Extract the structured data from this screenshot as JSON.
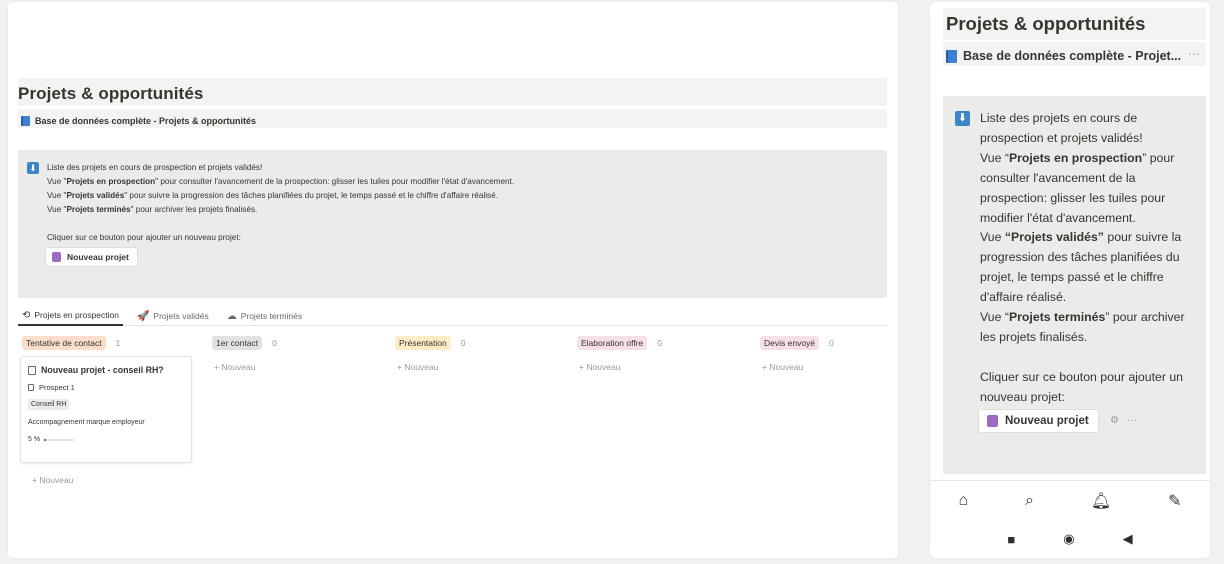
{
  "desktop": {
    "title": "Projets & opportunités",
    "subtitle": "Base de données complète - Projets & opportunités",
    "callout": {
      "lines": [
        {
          "pre": "Liste des projets en cours de prospection et projets validés!",
          "bold": "",
          "post": ""
        },
        {
          "pre": "Vue \"",
          "bold": "Projets en prospection",
          "post": "\" pour consulter l'avancement de la prospection: glisser les tuiles pour modifier l'état d'avancement."
        },
        {
          "pre": "Vue \"",
          "bold": "Projets validés",
          "post": "\" pour suivre la progression des tâches planifiées du projet, le temps passé et le chiffre d'affaire réalisé."
        },
        {
          "pre": "Vue \"",
          "bold": "Projets terminés",
          "post": "\" pour archiver les projets finalisés."
        }
      ],
      "cta_text": "Cliquer sur ce bouton pour ajouter un nouveau projet:",
      "button": "Nouveau projet"
    },
    "tabs": [
      {
        "label": "Projets en prospection",
        "icon": "sync-icon"
      },
      {
        "label": "Projets validés",
        "icon": "rocket-icon"
      },
      {
        "label": "Projets terminés",
        "icon": "cloud-icon"
      }
    ],
    "columns": [
      {
        "label": "Tentative de contact",
        "count": "1",
        "color": "#fadec9"
      },
      {
        "label": "1er contact",
        "count": "0",
        "color": "#e3e2e0"
      },
      {
        "label": "Présentation",
        "count": "0",
        "color": "#fdecc8"
      },
      {
        "label": "Elaboration offre",
        "count": "0",
        "color": "#f5e0e9"
      },
      {
        "label": "Devis envoyé",
        "count": "0",
        "color": "#f5e0e9"
      }
    ],
    "add_new": "+ Nouveau",
    "card": {
      "title": "Nouveau projet - conseil RH?",
      "prospect": "Prospect 1",
      "tag": "Conseil RH",
      "description": "Accompagnement marque employeur",
      "progress_label": "5 %",
      "progress": 0.05
    }
  },
  "mobile": {
    "title": "Projets & opportunités",
    "subtitle": "Base de données complète - Projet...",
    "more": "···",
    "callout": {
      "intro": "Liste des projets en cours de prospection et projets validés!",
      "p1_pre": "Vue “",
      "p1_bold": "Projets en prospection",
      "p1_post": "” pour consulter l'avancement de la prospection: glisser les tuiles pour modifier l'état d'avancement.",
      "p2_pre": "Vue ",
      "p2_bold": "“Projets validés”",
      "p2_post": " pour suivre la progression des tâches planifiées du projet, le temps passé et le chiffre d'affaire réalisé.",
      "p3_pre": "Vue “",
      "p3_bold": "Projets terminés",
      "p3_post": "” pour archiver les projets finalisés.",
      "cta_text": "Cliquer sur ce bouton pour ajouter un nouveau projet:",
      "button": "Nouveau projet",
      "button_more": "···"
    },
    "nav_icons": [
      "home-icon",
      "search-icon",
      "bell-icon",
      "compose-icon"
    ],
    "system_icons": [
      "stop-square-icon",
      "home-circle-icon",
      "back-triangle-icon"
    ]
  }
}
